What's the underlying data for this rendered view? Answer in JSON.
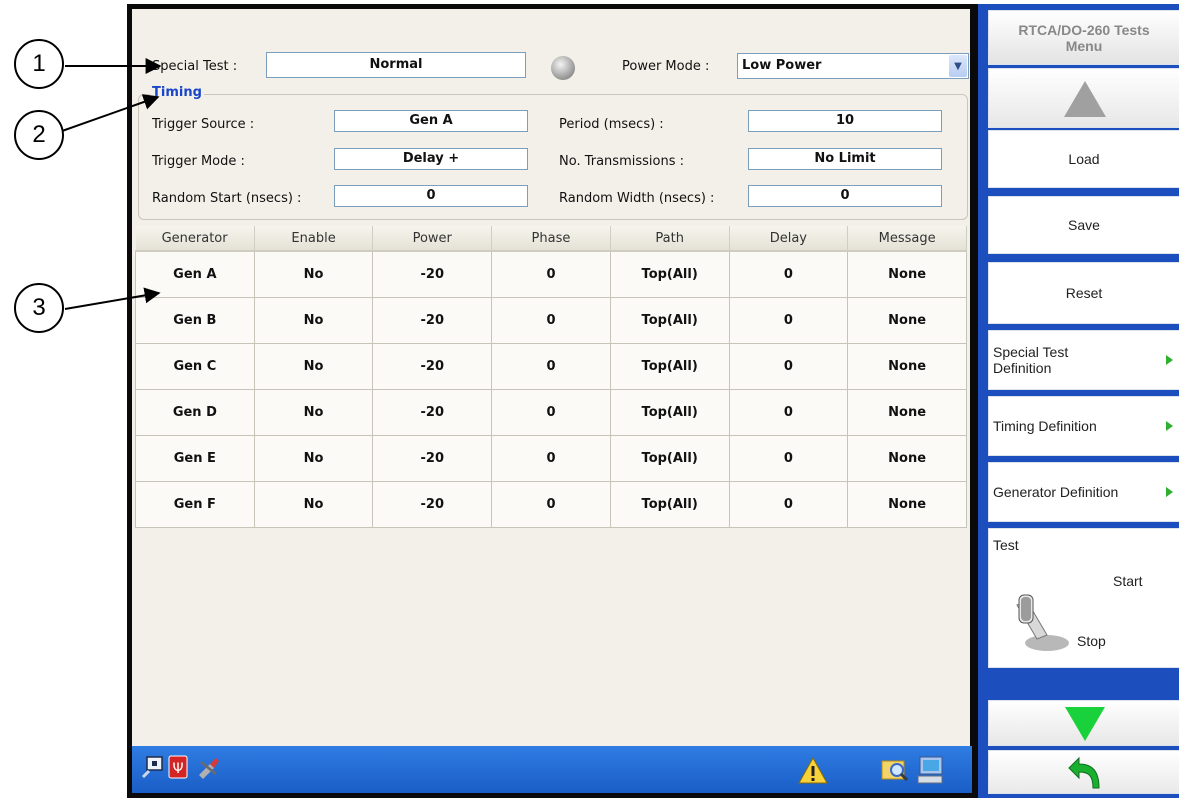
{
  "callouts": [
    "1",
    "2",
    "3"
  ],
  "special_test": {
    "label": "Special Test :",
    "value": "Normal"
  },
  "power_mode": {
    "label": "Power Mode :",
    "value": "Low Power"
  },
  "timing": {
    "title": "Timing",
    "trigger_source": {
      "label": "Trigger Source :",
      "value": "Gen A"
    },
    "trigger_mode": {
      "label": "Trigger Mode :",
      "value": "Delay +"
    },
    "random_start": {
      "label": "Random Start (nsecs) :",
      "value": "0"
    },
    "period": {
      "label": "Period (msecs) :",
      "value": "10"
    },
    "transmissions": {
      "label": "No. Transmissions :",
      "value": "No Limit"
    },
    "random_width": {
      "label": "Random Width (nsecs) :",
      "value": "0"
    }
  },
  "table": {
    "headers": [
      "Generator",
      "Enable",
      "Power",
      "Phase",
      "Path",
      "Delay",
      "Message"
    ],
    "rows": [
      [
        "Gen A",
        "No",
        "-20",
        "0",
        "Top(All)",
        "0",
        "None"
      ],
      [
        "Gen B",
        "No",
        "-20",
        "0",
        "Top(All)",
        "0",
        "None"
      ],
      [
        "Gen C",
        "No",
        "-20",
        "0",
        "Top(All)",
        "0",
        "None"
      ],
      [
        "Gen D",
        "No",
        "-20",
        "0",
        "Top(All)",
        "0",
        "None"
      ],
      [
        "Gen E",
        "No",
        "-20",
        "0",
        "Top(All)",
        "0",
        "None"
      ],
      [
        "Gen F",
        "No",
        "-20",
        "0",
        "Top(All)",
        "0",
        "None"
      ]
    ]
  },
  "menu": {
    "title": "RTCA/DO-260 Tests Menu",
    "load": "Load",
    "save": "Save",
    "reset": "Reset",
    "special_test_def": "Special Test Definition",
    "timing_def": "Timing Definition",
    "generator_def": "Generator Definition",
    "test": {
      "label": "Test",
      "start": "Start",
      "stop": "Stop"
    }
  },
  "icons": {
    "taskbar_left": [
      "network-icon",
      "usb-icon",
      "tools-icon"
    ],
    "taskbar_right": [
      "warning-icon",
      "search-folder-icon",
      "computer-icon"
    ],
    "side": [
      "up-arrow-icon",
      "down-arrow-icon",
      "back-arrow-icon"
    ]
  },
  "colors": {
    "accent": "#1c4fbd",
    "timing_title": "#1a45c8",
    "arrow_up": "#a0a0a0",
    "arrow_down": "#19d13a",
    "back_arrow": "#19b030"
  }
}
